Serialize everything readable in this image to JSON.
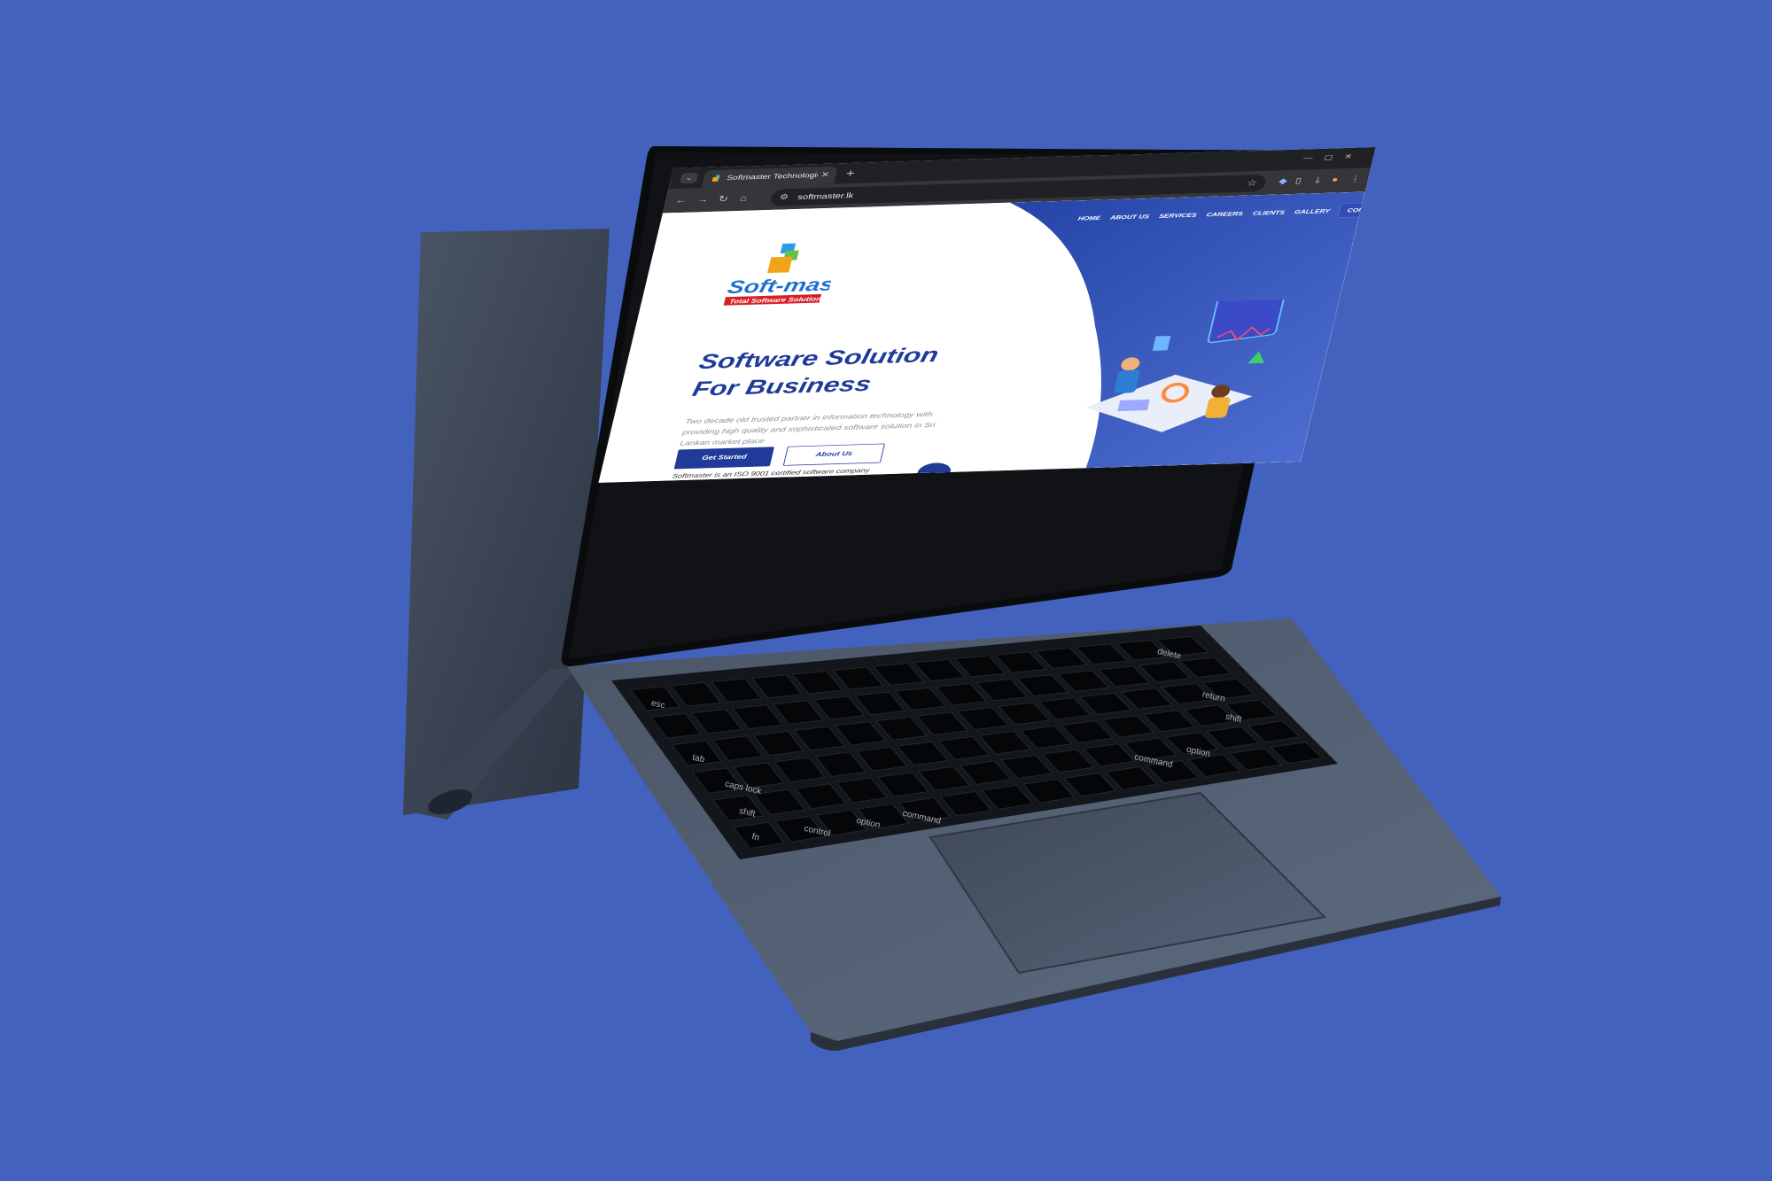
{
  "colors": {
    "background": "#4362bd",
    "brand_blue": "#1f3a99",
    "laptop_body": "#3f4a5c"
  },
  "browser": {
    "tab_title": "Softmaster Technologies Pvt Lt",
    "url": "softmaster.lk",
    "icons": [
      "chevron-down-icon",
      "close-icon",
      "plus-icon",
      "back-icon",
      "forward-icon",
      "reload-icon",
      "home-icon",
      "site-info-icon",
      "star-icon",
      "extension-icon",
      "download-icon",
      "menu-dots-icon"
    ]
  },
  "site": {
    "nav": [
      {
        "label": "HOME"
      },
      {
        "label": "ABOUT US"
      },
      {
        "label": "SERVICES"
      },
      {
        "label": "CAREERS"
      },
      {
        "label": "CLIENTS"
      },
      {
        "label": "GALLERY"
      },
      {
        "label": "CONTACT US"
      }
    ],
    "logo": {
      "name": "Soft-master",
      "tagline": "Total Software Solutions"
    },
    "hero": {
      "title": "Software Solution For Business",
      "description": "Two decade old trusted partner in information technology with providing high quality and sophisticated software solution in Sri Lankan market place",
      "primary_button": "Get Started",
      "secondary_button": "About Us",
      "partial_text": "Softmaster is an ISO 9001 certified software company"
    }
  },
  "keyboard": {
    "labels": [
      "esc",
      "tab",
      "caps lock",
      "shift",
      "fn",
      "control",
      "option",
      "command",
      "command",
      "option",
      "return",
      "shift",
      "delete"
    ]
  }
}
